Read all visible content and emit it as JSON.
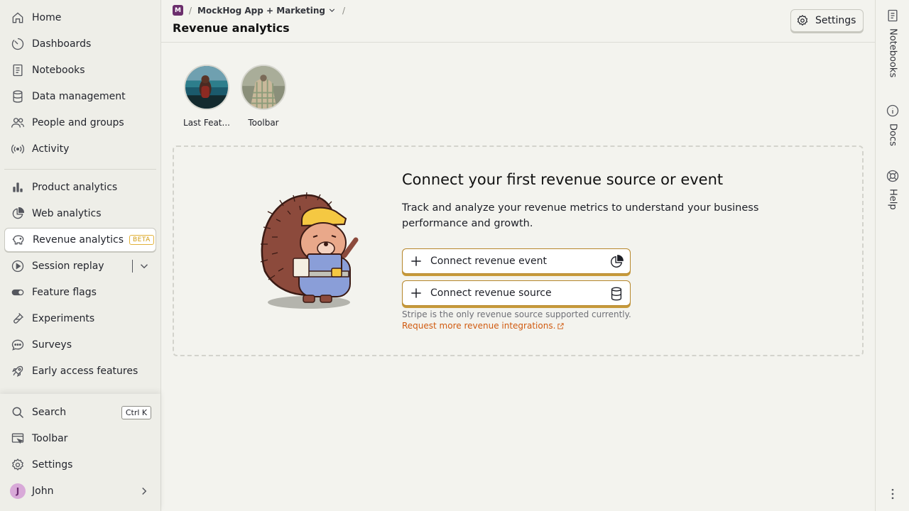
{
  "sidebar": {
    "items": [
      {
        "label": "Home",
        "icon": "home-icon"
      },
      {
        "label": "Dashboards",
        "icon": "dashboard-icon"
      },
      {
        "label": "Notebooks",
        "icon": "notebook-icon"
      },
      {
        "label": "Data management",
        "icon": "database-icon"
      },
      {
        "label": "People and groups",
        "icon": "people-icon"
      },
      {
        "label": "Activity",
        "icon": "activity-icon"
      },
      {
        "label": "Product analytics",
        "icon": "bar-chart-icon"
      },
      {
        "label": "Web analytics",
        "icon": "pie-chart-icon"
      },
      {
        "label": "Revenue analytics",
        "icon": "piggy-bank-icon",
        "badge": "BETA"
      },
      {
        "label": "Session replay",
        "icon": "play-icon"
      },
      {
        "label": "Feature flags",
        "icon": "toggle-icon"
      },
      {
        "label": "Experiments",
        "icon": "flask-icon"
      },
      {
        "label": "Surveys",
        "icon": "chat-bubble-icon"
      },
      {
        "label": "Early access features",
        "icon": "rocket-icon"
      }
    ],
    "bottom": {
      "search": "Search",
      "search_shortcut": "Ctrl K",
      "toolbar": "Toolbar",
      "settings": "Settings",
      "user": "John",
      "user_initial": "J"
    }
  },
  "header": {
    "project_initial": "M",
    "project_name": "MockHog App + Marketing",
    "title": "Revenue analytics",
    "settings_label": "Settings"
  },
  "rightbar": {
    "notebooks": "Notebooks",
    "docs": "Docs",
    "help": "Help"
  },
  "stories": [
    {
      "label": "Last Feat..."
    },
    {
      "label": "Toolbar"
    }
  ],
  "empty_state": {
    "title": "Connect your first revenue source or event",
    "description": "Track and analyze your revenue metrics to understand your business performance and growth.",
    "connect_event": "Connect revenue event",
    "connect_source": "Connect revenue source",
    "note": "Stripe is the only revenue source supported currently.",
    "link": "Request more revenue integrations."
  },
  "colors": {
    "accent": "#d05a0f",
    "button_border": "#b6862a",
    "beta": "#d19a0f"
  }
}
